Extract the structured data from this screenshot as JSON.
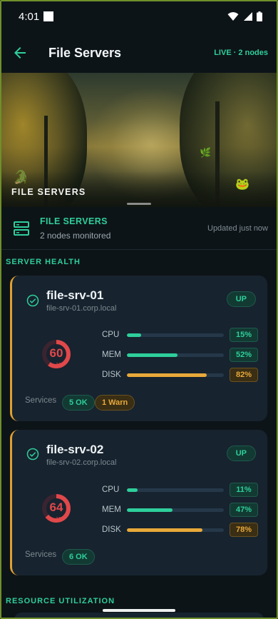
{
  "status_bar": {
    "time": "4:01"
  },
  "app_bar": {
    "title": "File Servers",
    "live_label": "LIVE · 2 nodes"
  },
  "hero": {
    "label": "FILE SERVERS"
  },
  "summary": {
    "heading": "FILE SERVERS",
    "subtitle": "2 nodes monitored",
    "updated": "Updated just now"
  },
  "sections": {
    "server_health": "SERVER HEALTH",
    "resource_utilization": "RESOURCE UTILIZATION"
  },
  "servers": [
    {
      "name": "file-srv-01",
      "host": "file-srv-01.corp.local",
      "status": "UP",
      "score": "60",
      "score_max": "100",
      "score_fraction": 0.6,
      "metrics": [
        {
          "label": "CPU",
          "value_text": "15%",
          "value": 15,
          "level": "ok"
        },
        {
          "label": "MEM",
          "value_text": "52%",
          "value": 52,
          "level": "ok"
        },
        {
          "label": "DISK",
          "value_text": "82%",
          "value": 82,
          "level": "warn"
        }
      ],
      "services_label": "Services",
      "chips": [
        {
          "text": "5 OK",
          "level": "ok"
        },
        {
          "text": "1 Warn",
          "level": "warn"
        }
      ]
    },
    {
      "name": "file-srv-02",
      "host": "file-srv-02.corp.local",
      "status": "UP",
      "score": "64",
      "score_max": "100",
      "score_fraction": 0.64,
      "metrics": [
        {
          "label": "CPU",
          "value_text": "11%",
          "value": 11,
          "level": "ok"
        },
        {
          "label": "MEM",
          "value_text": "47%",
          "value": 47,
          "level": "ok"
        },
        {
          "label": "DISK",
          "value_text": "78%",
          "value": 78,
          "level": "warn"
        }
      ],
      "services_label": "Services",
      "chips": [
        {
          "text": "6 OK",
          "level": "ok"
        }
      ]
    }
  ],
  "colors": {
    "accent": "#2ecf9a",
    "warn": "#e8a93a",
    "gauge": "#e0484a",
    "card_bg": "#17232f",
    "page_bg": "#0d1418"
  }
}
